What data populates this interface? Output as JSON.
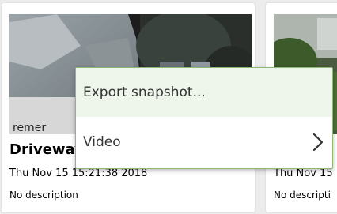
{
  "cards": [
    {
      "title": "Driveway",
      "timestamp": "Thu Nov 15 15:21:38 2018",
      "description": "No description",
      "watermark": "remer"
    },
    {
      "title": "",
      "timestamp": "Thu Nov 15",
      "description": "No descripti"
    }
  ],
  "context_menu": {
    "items": [
      {
        "label": "Export snapshot...",
        "highlighted": true
      },
      {
        "label": "Video",
        "icon": "chevron-right-icon"
      }
    ]
  },
  "colors": {
    "menu_border": "#8fb878",
    "menu_highlight": "#eef5ea",
    "page_background": "#ececec"
  }
}
